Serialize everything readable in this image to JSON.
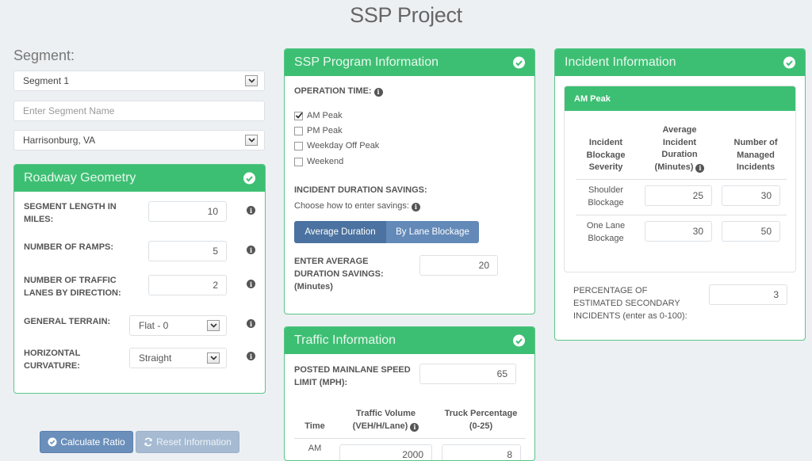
{
  "page": {
    "title": "SSP Project"
  },
  "segment": {
    "label": "Segment:",
    "selected": "Segment 1",
    "name_placeholder": "Enter Segment Name",
    "name_value": "",
    "location": "Harrisonburg, VA"
  },
  "roadway": {
    "title": "Roadway Geometry",
    "segment_length": {
      "label_1": "SEGMENT LENGTH IN",
      "label_2": "MILES:",
      "value": "10"
    },
    "ramps": {
      "label": "NUMBER OF RAMPS:",
      "value": "5"
    },
    "lanes": {
      "label_1": "NUMBER OF TRAFFIC",
      "label_2": "LANES BY DIRECTION:",
      "value": "2"
    },
    "terrain": {
      "label": "GENERAL TERRAIN:",
      "value": "Flat - 0"
    },
    "curvature": {
      "label_1": "HORIZONTAL",
      "label_2": "CURVATURE:",
      "value": "Straight"
    }
  },
  "actions": {
    "calculate": "Calculate Ratio",
    "reset": "Reset Information"
  },
  "ssp": {
    "title": "SSP Program Information",
    "operation_time_label": "OPERATION TIME:",
    "options": [
      {
        "label": "AM Peak",
        "checked": true
      },
      {
        "label": "PM Peak",
        "checked": false
      },
      {
        "label": "Weekday Off Peak",
        "checked": false
      },
      {
        "label": "Weekend",
        "checked": false
      }
    ],
    "savings_label": "INCIDENT DURATION SAVINGS:",
    "choose_label": "Choose how to enter savings:",
    "mode_average": "Average Duration",
    "mode_lane": "By Lane Blockage",
    "selected_mode": "Average Duration",
    "avg_label_1": "ENTER AVERAGE",
    "avg_label_2": "DURATION SAVINGS:",
    "avg_label_3": "(Minutes)",
    "avg_value": "20"
  },
  "traffic": {
    "title": "Traffic Information",
    "speed_label_1": "POSTED MAINLANE SPEED",
    "speed_label_2": "LIMIT (MPH):",
    "speed_value": "65",
    "col_time": "Time",
    "col_volume_1": "Traffic Volume",
    "col_volume_2": "(VEH/H/Lane)",
    "col_truck_1": "Truck Percentage",
    "col_truck_2": "(0-25)",
    "rows": [
      {
        "time": "AM",
        "volume": "2000",
        "truck": "8"
      }
    ]
  },
  "incident": {
    "title": "Incident Information",
    "sub_title": "AM Peak",
    "col_severity": [
      "Incident",
      "Blockage",
      "Severity"
    ],
    "col_duration": [
      "Average",
      "Incident",
      "Duration",
      "(Minutes)"
    ],
    "col_managed": [
      "Number of",
      "Managed",
      "Incidents"
    ],
    "rows": [
      {
        "severity_1": "Shoulder",
        "severity_2": "Blockage",
        "duration": "25",
        "managed": "30"
      },
      {
        "severity_1": "One Lane",
        "severity_2": "Blockage",
        "duration": "30",
        "managed": "50"
      }
    ],
    "secondary_label_1": "PERCENTAGE OF",
    "secondary_label_2": "ESTIMATED SECONDARY",
    "secondary_label_3": "INCIDENTS (enter as 0-100):",
    "secondary_value": "3"
  }
}
